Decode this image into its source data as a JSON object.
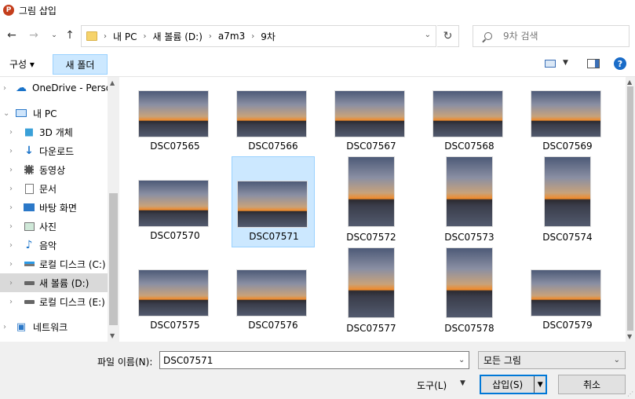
{
  "window": {
    "title": "그림 삽입",
    "app_icon_letter": "P"
  },
  "nav": {
    "breadcrumb": [
      "내 PC",
      "새 볼륨 (D:)",
      "a7m3",
      "9차"
    ],
    "search_placeholder": "9차 검색"
  },
  "toolbar": {
    "organize": "구성 ▾",
    "new_folder": "새 폴더"
  },
  "sidebar": {
    "items": [
      {
        "label": "OneDrive - Persor",
        "icon": "cloud-icon"
      },
      {
        "label": "내 PC",
        "icon": "computer-icon"
      },
      {
        "label": "3D 개체",
        "icon": "cube-icon"
      },
      {
        "label": "다운로드",
        "icon": "download-arrow-icon"
      },
      {
        "label": "동영상",
        "icon": "film-icon"
      },
      {
        "label": "문서",
        "icon": "document-icon"
      },
      {
        "label": "바탕 화면",
        "icon": "desktop-icon"
      },
      {
        "label": "사진",
        "icon": "picture-icon"
      },
      {
        "label": "음악",
        "icon": "music-note-icon"
      },
      {
        "label": "로컬 디스크 (C:)",
        "icon": "windows-drive-icon"
      },
      {
        "label": "새 볼륨 (D:)",
        "icon": "drive-icon"
      },
      {
        "label": "로컬 디스크 (E:)",
        "icon": "drive-icon"
      },
      {
        "label": "네트워크",
        "icon": "network-icon"
      }
    ]
  },
  "files": [
    {
      "name": "DSC07565",
      "orientation": "landscape"
    },
    {
      "name": "DSC07566",
      "orientation": "landscape"
    },
    {
      "name": "DSC07567",
      "orientation": "landscape"
    },
    {
      "name": "DSC07568",
      "orientation": "landscape"
    },
    {
      "name": "DSC07569",
      "orientation": "landscape"
    },
    {
      "name": "DSC07570",
      "orientation": "landscape"
    },
    {
      "name": "DSC07571",
      "orientation": "landscape",
      "selected": true
    },
    {
      "name": "DSC07572",
      "orientation": "portrait"
    },
    {
      "name": "DSC07573",
      "orientation": "portrait"
    },
    {
      "name": "DSC07574",
      "orientation": "portrait"
    },
    {
      "name": "DSC07575",
      "orientation": "landscape"
    },
    {
      "name": "DSC07576",
      "orientation": "landscape"
    },
    {
      "name": "DSC07577",
      "orientation": "portrait"
    },
    {
      "name": "DSC07578",
      "orientation": "portrait"
    },
    {
      "name": "DSC07579",
      "orientation": "landscape"
    }
  ],
  "bottom": {
    "filename_label": "파일 이름(N):",
    "filename_value": "DSC07571",
    "filter_value": "모든 그림",
    "tools": "도구(L)",
    "insert": "삽입(S)",
    "cancel": "취소"
  },
  "colors": {
    "accent": "#0078d7",
    "selection": "#cce8ff",
    "selection_border": "#99d1ff"
  }
}
